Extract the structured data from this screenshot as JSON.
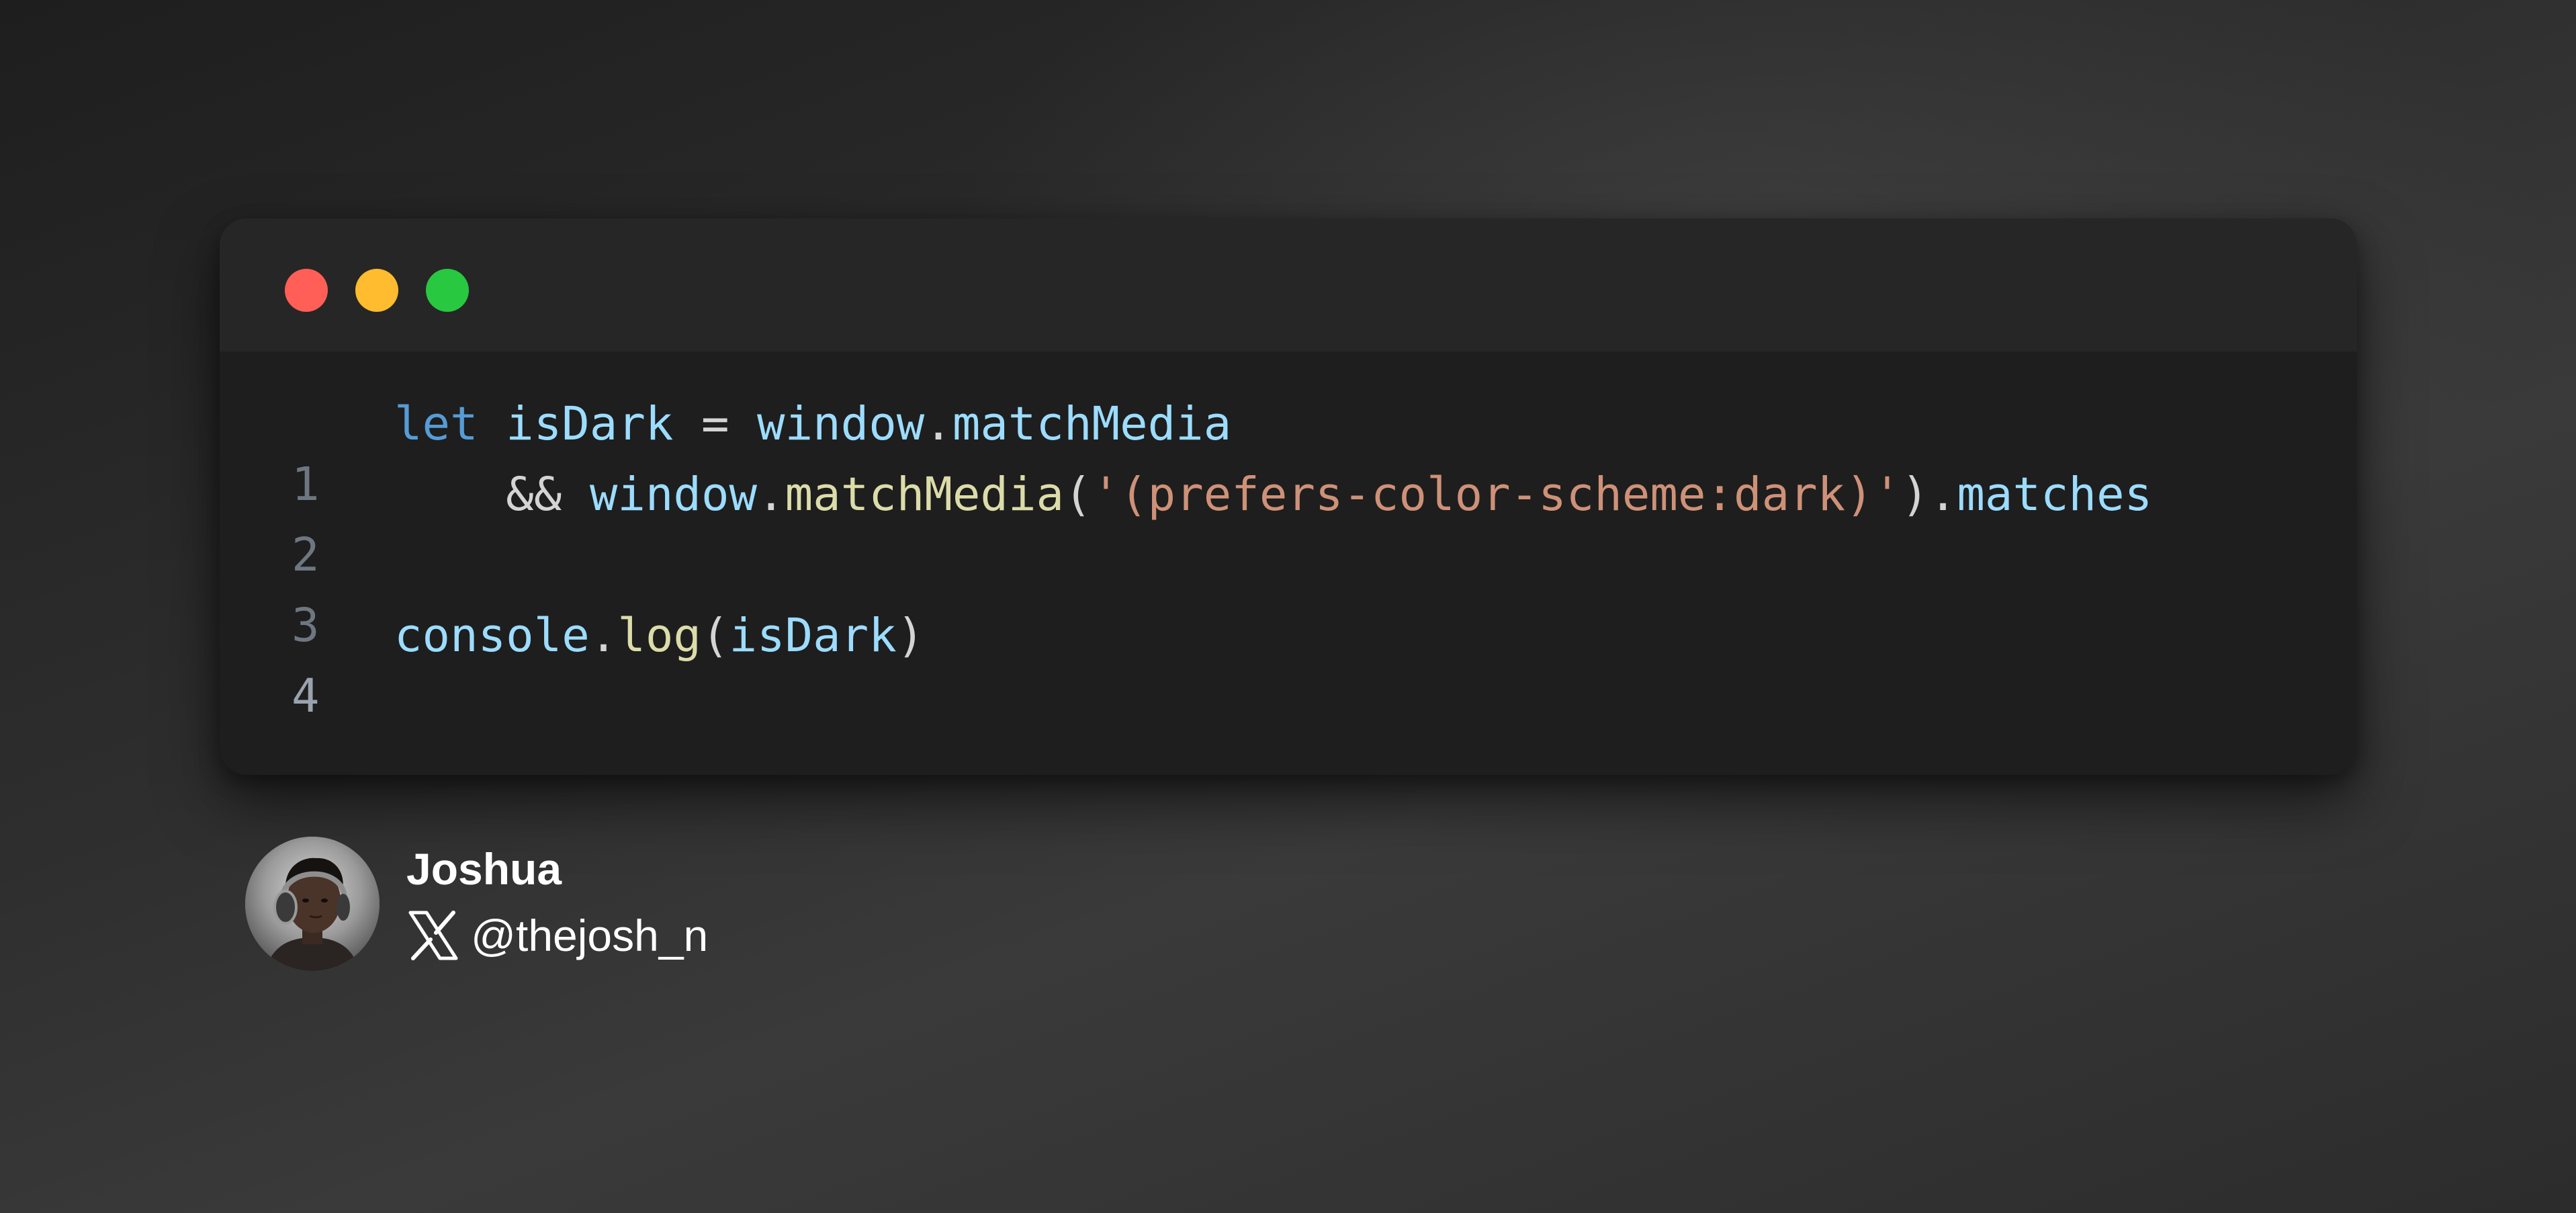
{
  "window": {
    "controls": {
      "close_color": "#ff5f57",
      "minimize_color": "#febc2e",
      "maximize_color": "#28c840"
    }
  },
  "code": {
    "lines": [
      {
        "number": "1",
        "tokens": [
          "let",
          " ",
          "isDark",
          " = ",
          "window",
          ".",
          "matchMedia"
        ]
      },
      {
        "number": "2",
        "tokens": [
          "    ",
          "&&",
          " ",
          "window",
          ".",
          "matchMedia",
          "(",
          "'(prefers-color-scheme:dark)'",
          ")",
          ".",
          "matches"
        ]
      },
      {
        "number": "3",
        "tokens": []
      },
      {
        "number": "4",
        "tokens": [
          "console",
          ".",
          "log",
          "(",
          "isDark",
          ")"
        ]
      }
    ]
  },
  "author": {
    "name": "Joshua",
    "handle": "@thejosh_n",
    "social_icon": "x-logo-icon",
    "avatar_icon": "avatar-headphones-portrait"
  }
}
